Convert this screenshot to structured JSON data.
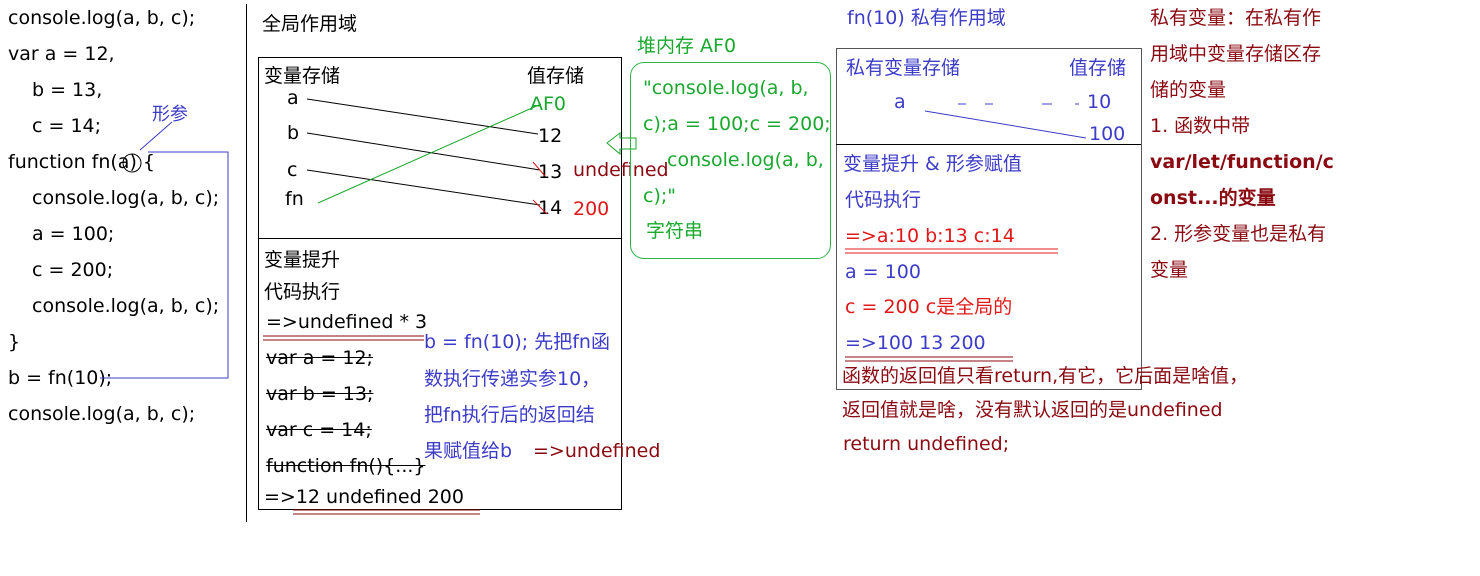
{
  "code": {
    "lines": [
      "console.log(a, b, c);",
      "var a = 12,",
      "b = 13,",
      "c = 14;",
      "function fn(a) {",
      "console.log(a, b, c);",
      "a = 100;",
      "c = 200;",
      "console.log(a, b, c);",
      "}",
      "b = fn(10);",
      "console.log(a, b, c);"
    ],
    "param_note": "形参"
  },
  "global": {
    "title": "全局作用域",
    "var_store_label": "变量存储",
    "value_store_label": "值存储",
    "vars": [
      "a",
      "b",
      "c",
      "fn"
    ],
    "values": [
      "AF0",
      "12",
      "13",
      "14"
    ],
    "value_note_undefined": "undefined",
    "value_note_200": "200",
    "hoist_label": "变量提升",
    "exec_label": "代码执行",
    "result1": "=>undefined * 3",
    "struck": [
      "var a = 12;",
      "var b = 13;",
      "var c = 14;",
      "function fn(){...}"
    ],
    "result2": "=>12  undefined  200",
    "fn_note": [
      "b = fn(10); 先把fn函",
      "数执行传递实参10，",
      "把fn执行后的返回结",
      "果赋值给b "
    ],
    "fn_note_result": "=>undefined"
  },
  "heap": {
    "title": "堆内存 AF0",
    "content": [
      "\"console.log(a, b,",
      "c);a = 100;c = 200;",
      "console.log(a, b,",
      "c);\""
    ],
    "note": "字符串"
  },
  "private": {
    "title": "fn(10) 私有作用域",
    "var_store_label": "私有变量存储",
    "value_store_label": "值存储",
    "var": "a",
    "value_old": "10",
    "value_new": "100",
    "hoist_label": "变量提升 & 形参赋值",
    "exec_label": "代码执行",
    "result1": "=>a:10  b:13 c:14",
    "stmt1": "a = 100",
    "stmt2": "c = 200  c是全局的",
    "result2": "=>100   13   200",
    "return_note": [
      "函数的返回值只看return,有它，它后面是啥值，",
      "返回值就是啥，没有默认返回的是undefined",
      "return undefined;"
    ]
  },
  "notes": {
    "lines": [
      "私有变量：在私有作",
      "用域中变量存储区存",
      "储的变量",
      "1. 函数中带",
      "var/let/function/c",
      "onst...的变量",
      "2. 形参变量也是私有",
      "变量"
    ]
  },
  "colors": {
    "blue": "#3c3cc8",
    "green": "#1aa82e",
    "red": "#e01818",
    "dark_red": "#8b0a12"
  }
}
